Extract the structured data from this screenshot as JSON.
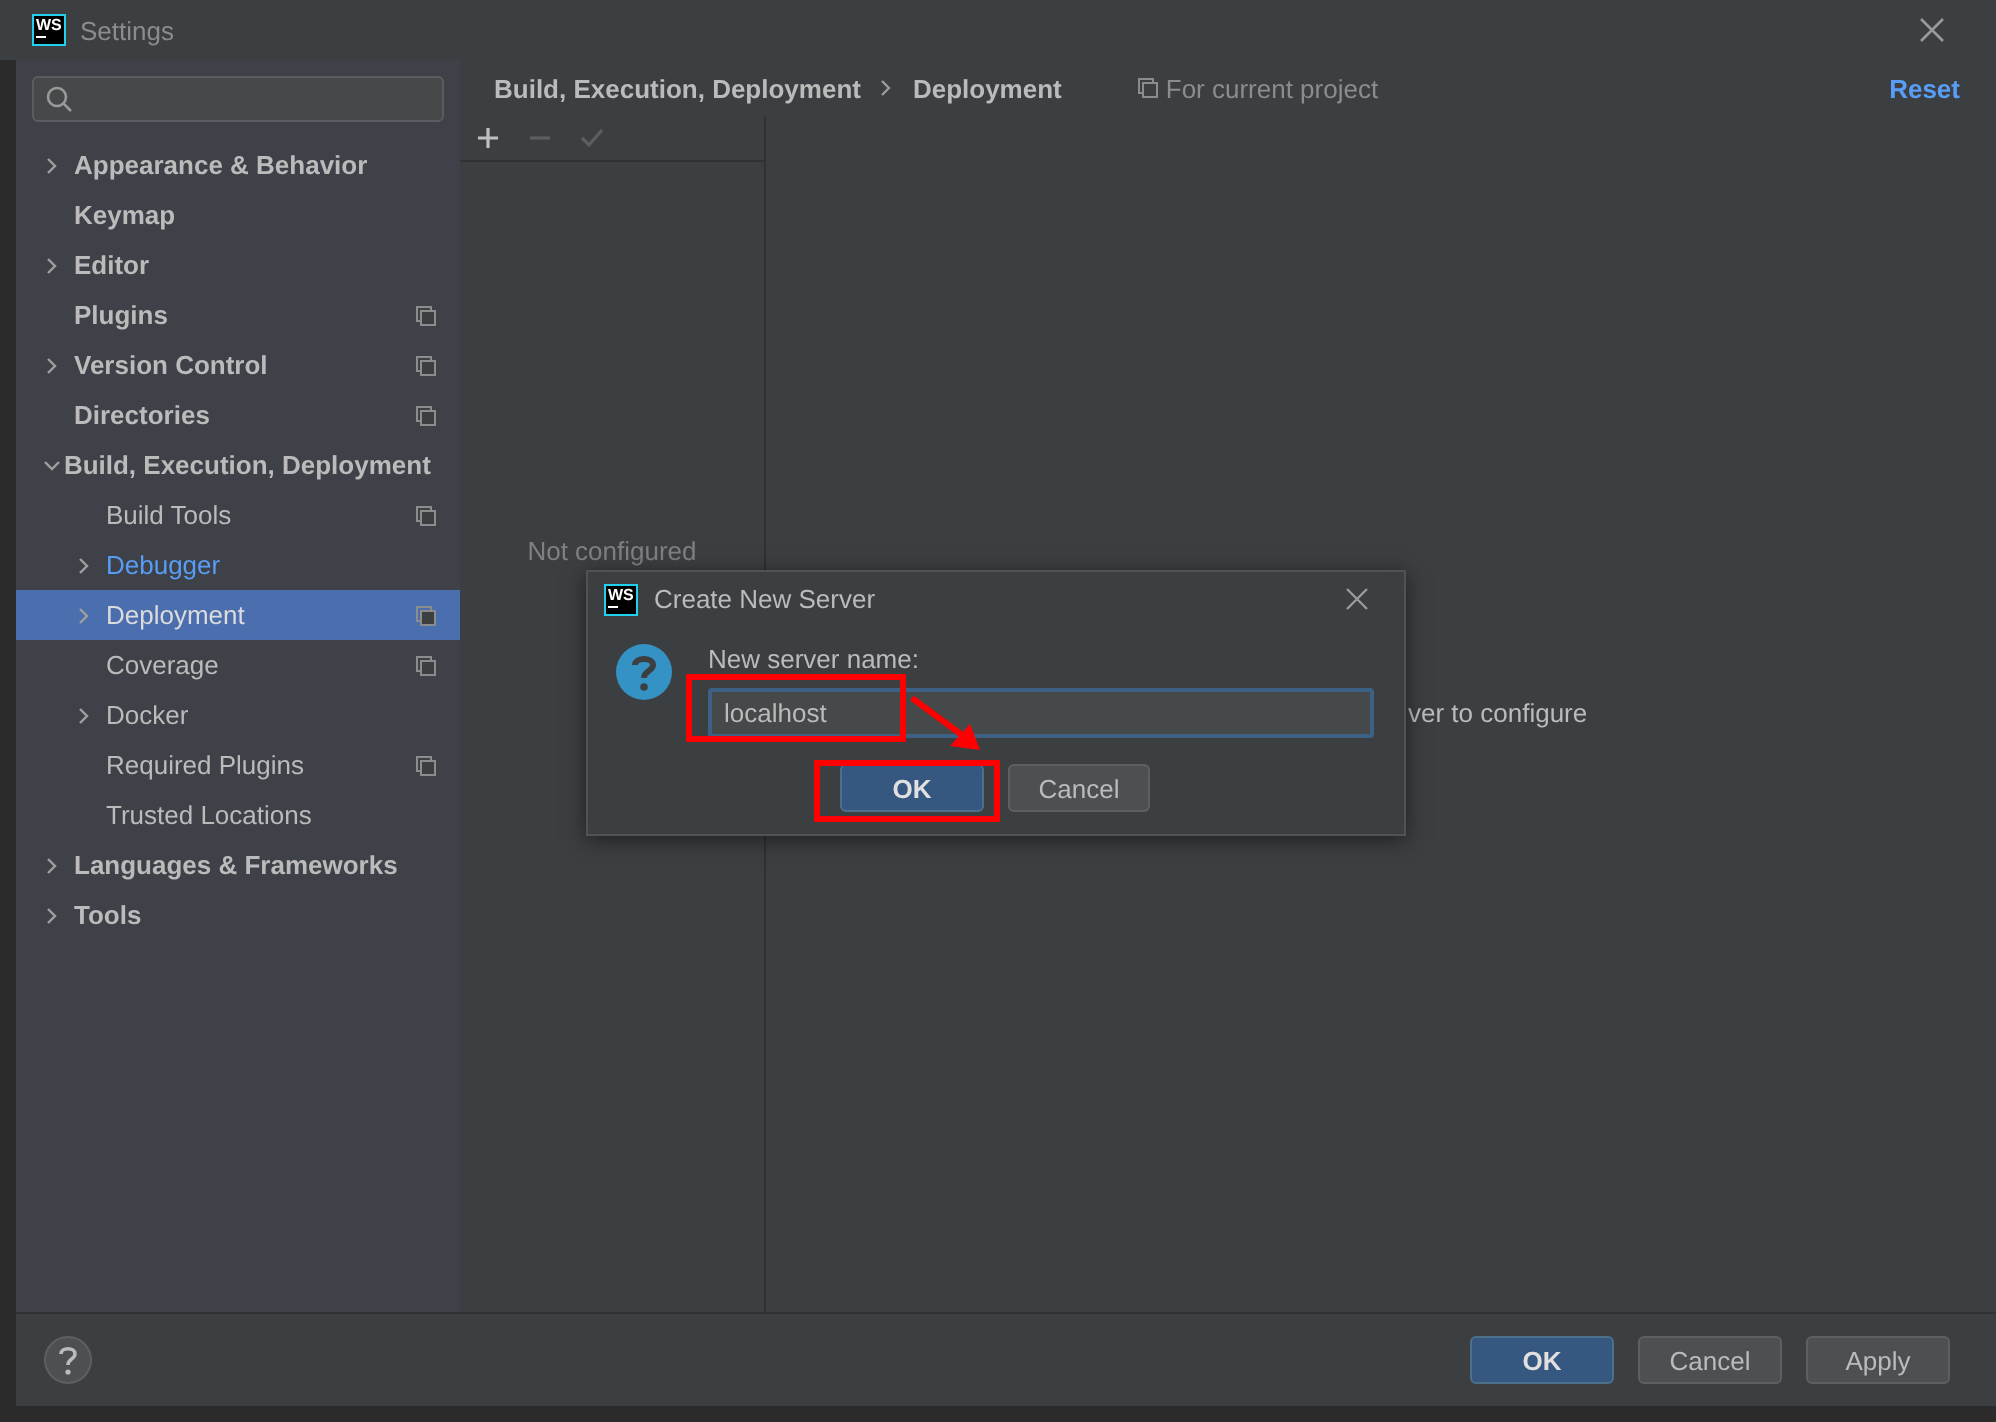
{
  "window": {
    "logo": "WS",
    "title": "Settings"
  },
  "sidebar": {
    "items": [
      {
        "label": "Appearance & Behavior",
        "expanded": false,
        "project_scope": false,
        "modified": false,
        "selected": false
      },
      {
        "label": "Keymap",
        "project_scope": false,
        "modified": false,
        "selected": false
      },
      {
        "label": "Editor",
        "expanded": false,
        "project_scope": false,
        "modified": false,
        "selected": false
      },
      {
        "label": "Plugins",
        "project_scope": true,
        "modified": false,
        "selected": false
      },
      {
        "label": "Version Control",
        "expanded": false,
        "project_scope": true,
        "modified": false,
        "selected": false
      },
      {
        "label": "Directories",
        "project_scope": true,
        "modified": false,
        "selected": false
      },
      {
        "label": "Build, Execution, Deployment",
        "expanded": true,
        "project_scope": false,
        "modified": false,
        "selected": false,
        "children": [
          {
            "label": "Build Tools",
            "project_scope": true,
            "modified": false,
            "selected": false
          },
          {
            "label": "Debugger",
            "expanded": false,
            "project_scope": false,
            "modified": true,
            "selected": false
          },
          {
            "label": "Deployment",
            "expanded": false,
            "project_scope": true,
            "modified": false,
            "selected": true
          },
          {
            "label": "Coverage",
            "project_scope": true,
            "modified": false,
            "selected": false
          },
          {
            "label": "Docker",
            "expanded": false,
            "project_scope": false,
            "modified": false,
            "selected": false
          },
          {
            "label": "Required Plugins",
            "project_scope": true,
            "modified": false,
            "selected": false
          },
          {
            "label": "Trusted Locations",
            "project_scope": false,
            "modified": false,
            "selected": false
          }
        ]
      },
      {
        "label": "Languages & Frameworks",
        "expanded": false,
        "project_scope": false,
        "modified": false,
        "selected": false
      },
      {
        "label": "Tools",
        "expanded": false,
        "project_scope": false,
        "modified": false,
        "selected": false
      }
    ]
  },
  "breadcrumb": [
    "Build, Execution, Deployment",
    "Deployment"
  ],
  "scope_note": "For current project",
  "reset": "Reset",
  "toolbar": [
    {
      "kind": "add",
      "disabled": false
    },
    {
      "kind": "remove",
      "disabled": true
    },
    {
      "kind": "apply",
      "disabled": true
    }
  ],
  "server_list": {
    "empty_text": "Not configured"
  },
  "details": {
    "hint": "ver to configure"
  },
  "dialog": {
    "logo": "WS",
    "title": "Create New Server",
    "label": "New server name:",
    "value": "localhost",
    "buttons": [
      {
        "label": "OK",
        "default": true
      },
      {
        "label": "Cancel",
        "default": false
      }
    ]
  },
  "annotations": [
    {
      "kind": "box"
    },
    {
      "kind": "box"
    },
    {
      "kind": "arrow"
    }
  ],
  "footer": {
    "buttons": [
      {
        "label": "OK",
        "default": true
      },
      {
        "label": "Cancel",
        "default": false
      },
      {
        "label": "Apply",
        "default": false
      }
    ]
  }
}
